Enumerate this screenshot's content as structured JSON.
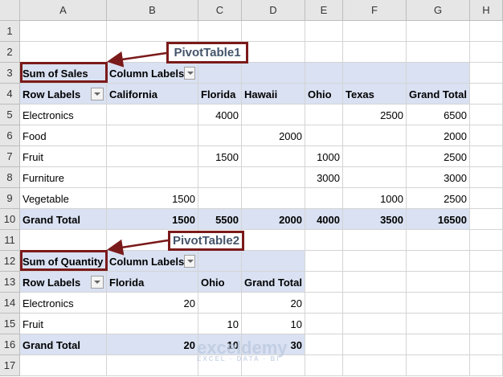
{
  "columns": [
    "A",
    "B",
    "C",
    "D",
    "E",
    "F",
    "G",
    "H"
  ],
  "rows": [
    "1",
    "2",
    "3",
    "4",
    "5",
    "6",
    "7",
    "8",
    "9",
    "10",
    "11",
    "12",
    "13",
    "14",
    "15",
    "16",
    "17"
  ],
  "callouts": {
    "pt1": "PivotTable1",
    "pt2": "PivotTable2"
  },
  "watermark": {
    "name": "exceldemy",
    "tagline": "EXCEL · DATA · BI"
  },
  "colors": {
    "pivot_fill": "#d9e1f2",
    "callout_border": "#7b1a1a"
  },
  "pivot1": {
    "value_field": "Sum of Sales",
    "column_labels": "Column Labels",
    "row_labels": "Row Labels",
    "headers": [
      "California",
      "Florida",
      "Hawaii",
      "Ohio",
      "Texas",
      "Grand Total"
    ],
    "rows": [
      {
        "label": "Electronics",
        "values": [
          "",
          "4000",
          "",
          "",
          "2500",
          "6500"
        ]
      },
      {
        "label": "Food",
        "values": [
          "",
          "",
          "2000",
          "",
          "",
          "2000"
        ]
      },
      {
        "label": "Fruit",
        "values": [
          "",
          "1500",
          "",
          "1000",
          "",
          "2500"
        ]
      },
      {
        "label": "Furniture",
        "values": [
          "",
          "",
          "",
          "3000",
          "",
          "3000"
        ]
      },
      {
        "label": "Vegetable",
        "values": [
          "1500",
          "",
          "",
          "",
          "1000",
          "2500"
        ]
      }
    ],
    "total": {
      "label": "Grand Total",
      "values": [
        "1500",
        "5500",
        "2000",
        "4000",
        "3500",
        "16500"
      ]
    }
  },
  "pivot2": {
    "value_field": "Sum of Quantity",
    "column_labels": "Column Labels",
    "row_labels": "Row Labels",
    "headers": [
      "Florida",
      "Ohio",
      "Grand Total"
    ],
    "rows": [
      {
        "label": "Electronics",
        "values": [
          "20",
          "",
          "20"
        ]
      },
      {
        "label": "Fruit",
        "values": [
          "",
          "10",
          "10"
        ]
      }
    ],
    "total": {
      "label": "Grand Total",
      "values": [
        "20",
        "10",
        "30"
      ]
    }
  }
}
